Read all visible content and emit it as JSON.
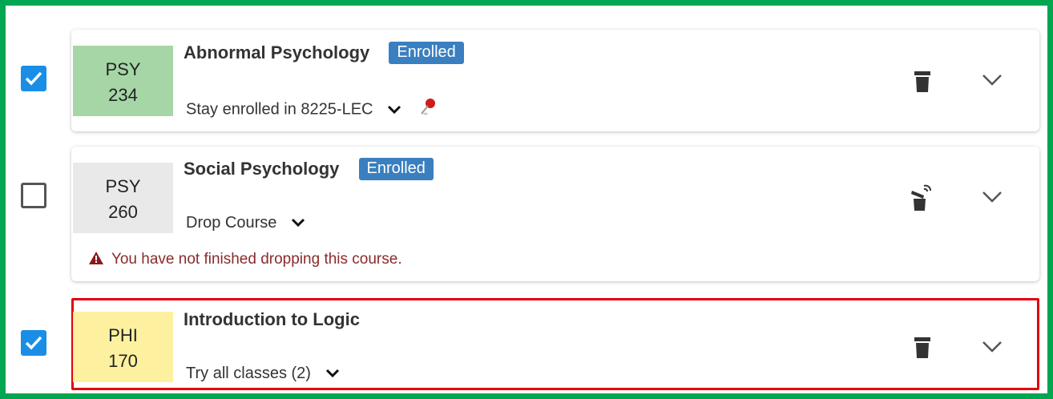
{
  "courses": [
    {
      "checked": true,
      "subject": "PSY",
      "number": "234",
      "code_color": "#a6d6a6",
      "title": "Abnormal Psychology",
      "badge": "Enrolled",
      "option": "Stay enrolled in 8225-LEC",
      "pinned": true,
      "action_icon": "trash-icon"
    },
    {
      "checked": false,
      "subject": "PSY",
      "number": "260",
      "code_color": "#e9e9e9",
      "title": "Social Psychology",
      "badge": "Enrolled",
      "option": "Drop Course",
      "warning": "You have not finished dropping this course.",
      "action_icon": "drop-trash-icon"
    },
    {
      "checked": true,
      "subject": "PHI",
      "number": "170",
      "code_color": "#fdf1a0",
      "title": "Introduction to Logic",
      "option": "Try all classes (2)",
      "highlighted": true,
      "action_icon": "trash-icon"
    }
  ],
  "colors": {
    "frame": "#00a651",
    "highlight": "#e3000f",
    "checkbox": "#1a8ee6",
    "badge": "#3a7fbf",
    "warning": "#8b2a2a"
  }
}
